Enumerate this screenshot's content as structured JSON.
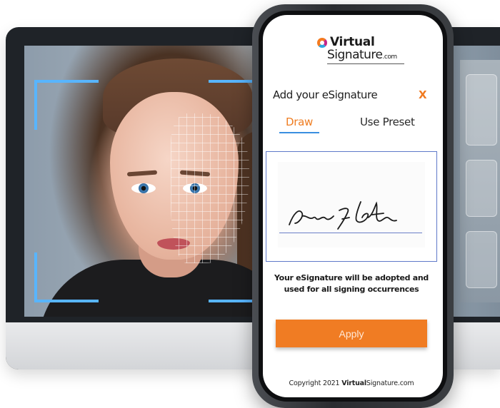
{
  "brand": {
    "name_top": "Virtual",
    "name_bottom": "Signature",
    "name_suffix": ".com"
  },
  "dialog": {
    "title": "Add your eSignature",
    "close_label": "X"
  },
  "tabs": [
    {
      "label": "Draw",
      "active": true
    },
    {
      "label": "Use Preset",
      "active": false
    }
  ],
  "signature": {
    "notice_line1": "Your eSignature will be adopted and",
    "notice_line2": "used for all signing occurrences"
  },
  "actions": {
    "apply_label": "Apply"
  },
  "footer": {
    "copyright_prefix": "Copyright 2021",
    "brand_bold": "Virtual",
    "brand_rest": "Signature.com"
  },
  "colors": {
    "accent": "#f07c23",
    "tab_underline": "#3a8fe0",
    "face_frame": "#58b5ff"
  },
  "icons": {
    "logo": "swirl-logo-icon"
  }
}
